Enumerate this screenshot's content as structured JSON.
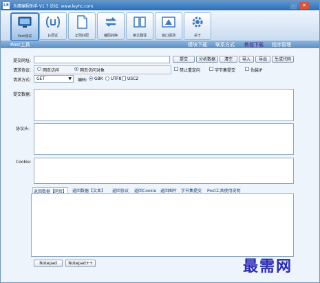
{
  "window": {
    "title": "乐鹰编程助手 V1.7 论坛: www.leyhc.com",
    "logo_text": "LE"
  },
  "toolbar": [
    {
      "label": "Post测试",
      "icon": "monitor-icon",
      "active": true
    },
    {
      "label": "Js调试",
      "icon": "js-icon",
      "active": false
    },
    {
      "label": "正则匹配",
      "icon": "document-icon",
      "active": false
    },
    {
      "label": "编码转换",
      "icon": "convert-icon",
      "active": false
    },
    {
      "label": "英文翻译",
      "icon": "book-icon",
      "active": false
    },
    {
      "label": "窗口探测",
      "icon": "window-probe-icon",
      "active": false
    },
    {
      "label": "关于",
      "icon": "gear-icon",
      "active": false
    }
  ],
  "section_title": "Post工具",
  "menu": [
    {
      "label": "模块下载",
      "active": false
    },
    {
      "label": "联系方式",
      "active": false
    },
    {
      "label": "教程下载",
      "active": true
    },
    {
      "label": "程序管理",
      "active": false
    }
  ],
  "form": {
    "url_label": "提交网址:",
    "url_value": "",
    "buttons": [
      "提交",
      "分析数据",
      "清空",
      "导入",
      "导出",
      "生成代码"
    ],
    "protocol_label": "请求协议:",
    "protocol_options": [
      "网页访问",
      "网页访问对象"
    ],
    "protocol_selected": 1,
    "checkboxes": [
      "禁止重定向",
      "字节集提交",
      "伪装IP"
    ],
    "method_label": "请求方式:",
    "method_value": "GET",
    "encoding_label": "编码:",
    "encoding_options": [
      "GBK",
      "UTF8"
    ],
    "encoding_selected": 0,
    "usc2_label": "USC2",
    "post_data_label": "提交数据:",
    "headers_label": "协议头:",
    "cookie_label": "Cookie:"
  },
  "result_tabs": [
    "返回数据【网页】",
    "返回数据【文本】",
    "返回协议",
    "返回Cookie",
    "返回图片",
    "字节集提交",
    "Post工具使用说明"
  ],
  "result_tab_active": 0,
  "bottom_buttons": [
    "Notepad",
    "Notepad++"
  ],
  "watermark": "最需网",
  "colors": {
    "titlebar": "#2c6db5",
    "active_menu": "#4a1d8a",
    "watermark": "#2a2ab8"
  }
}
